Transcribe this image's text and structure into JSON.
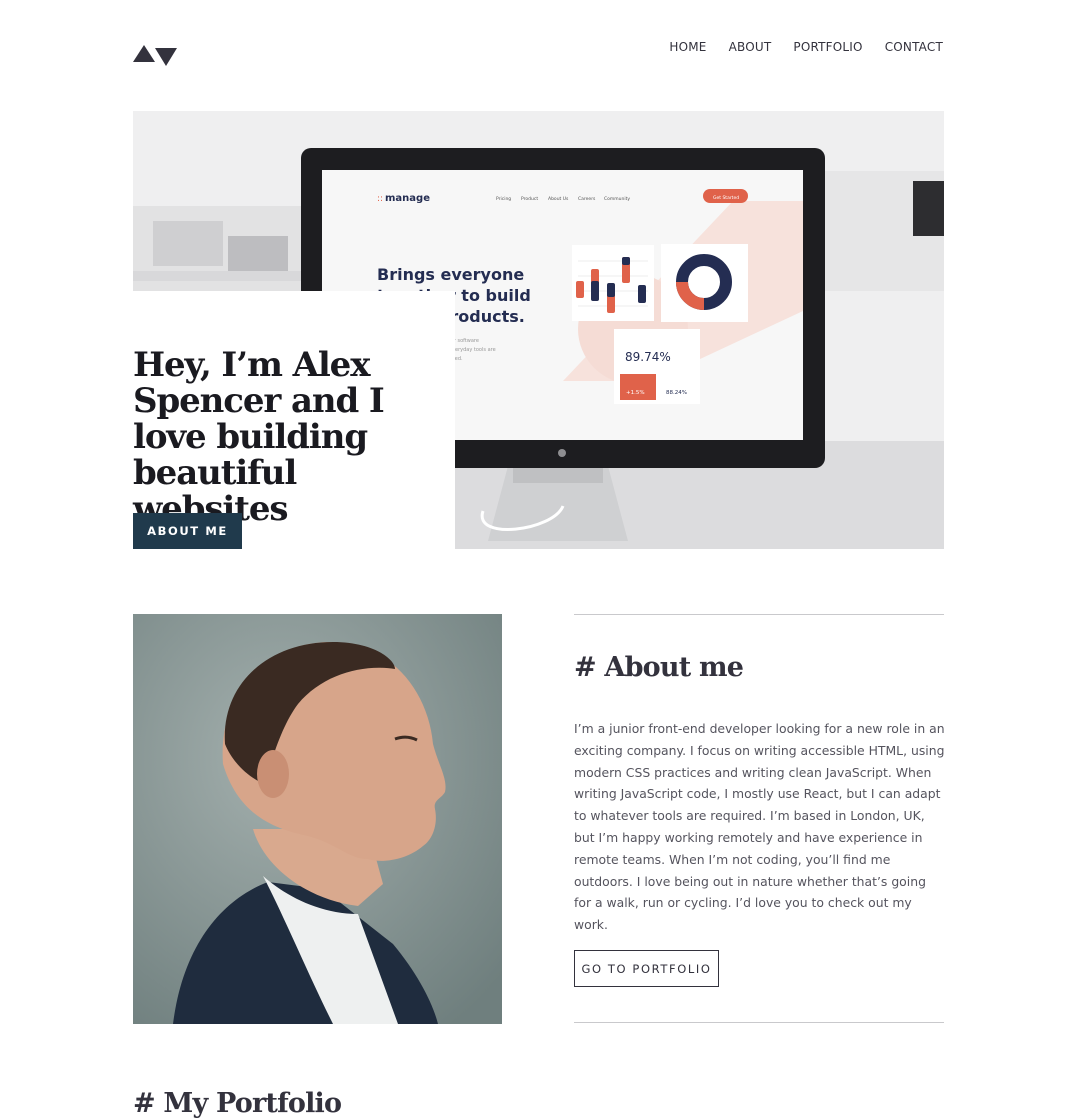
{
  "nav": {
    "items": [
      "HOME",
      "ABOUT",
      "PORTFOLIO",
      "CONTACT"
    ]
  },
  "hero": {
    "title": "Hey, I’m Alex Spencer and I love building beautiful websites",
    "button_label": "ABOUT ME",
    "screen": {
      "brand": "manage",
      "links": [
        "Pricing",
        "Product",
        "About Us",
        "Careers",
        "Community"
      ],
      "cta": "Get Started",
      "headline_lines": [
        "Brings everyone",
        "together to build",
        "better products."
      ],
      "subtext_lines": [
        "for software",
        "everyday tools are",
        "used."
      ],
      "stat": "89.74%",
      "badge": "+1.5%",
      "small_stat": "88.24%"
    }
  },
  "about": {
    "title": "# About me",
    "text": "I’m a junior front-end developer looking for a new role in an exciting company. I focus on writing accessible HTML, using modern CSS practices and writing clean JavaScript. When writing JavaScript code, I mostly use React, but I can adapt to whatever tools are required. I’m based in London, UK, but I’m happy working remotely and have experience in remote teams. When I’m not coding, you’ll find me outdoors. I love being out in nature whether that’s going for a walk, run or cycling. I’d love you to check out my work.",
    "button_label": "GO TO PORTFOLIO"
  },
  "portfolio": {
    "title": "# My Portfolio"
  },
  "colors": {
    "primary_button": "#203a4c",
    "text_dark": "#33323d",
    "accent_orange": "#e0624a"
  }
}
